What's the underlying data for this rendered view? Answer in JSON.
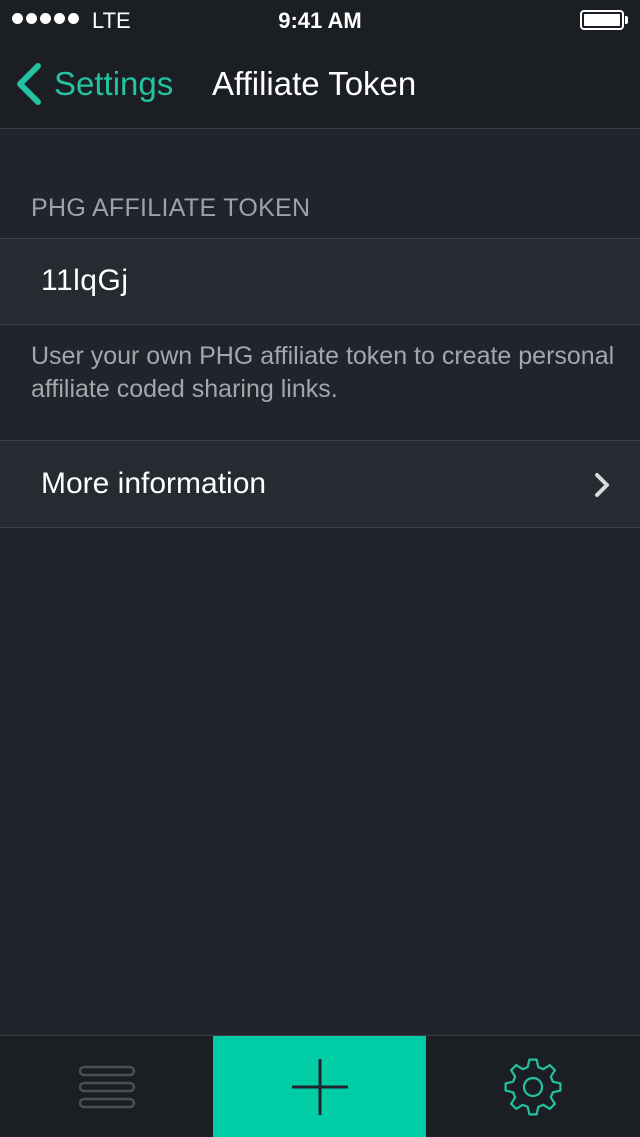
{
  "status_bar": {
    "carrier": "LTE",
    "time": "9:41 AM",
    "signal_icon": "signal-dots-icon",
    "battery_icon": "battery-icon",
    "battery_level": 1.0
  },
  "nav": {
    "back_label": "Settings",
    "title": "Affiliate Token",
    "back_icon": "chevron-left-icon"
  },
  "section": {
    "header": "PHG AFFILIATE TOKEN",
    "token_value": "11lqGj",
    "footer": "User your own PHG affiliate token to create personal affiliate coded sharing links."
  },
  "more_info": {
    "label": "More information",
    "icon": "chevron-right-icon"
  },
  "tab_bar": {
    "items": [
      {
        "icon": "list-icon"
      },
      {
        "icon": "plus-icon"
      },
      {
        "icon": "gear-icon"
      }
    ]
  },
  "colors": {
    "accent": "#22c2a2",
    "tab_active_bg": "#00cda6",
    "background": "#21252b",
    "bar_background": "#1b1e22"
  }
}
